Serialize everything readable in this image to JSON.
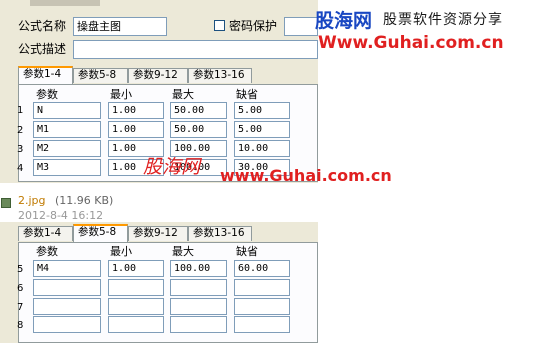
{
  "form": {
    "name_label": "公式名称",
    "name_value": "操盘主图",
    "password_label": "密码保护",
    "desc_label": "公式描述",
    "desc_value": ""
  },
  "tabs": [
    "参数1-4",
    "参数5-8",
    "参数9-12",
    "参数13-16"
  ],
  "columns": [
    "参数",
    "最小",
    "最大",
    "缺省"
  ],
  "panel1": {
    "active_tab": "参数1-4",
    "rows": [
      {
        "num": "1",
        "name": "N",
        "min": "1.00",
        "max": "50.00",
        "default": "5.00"
      },
      {
        "num": "2",
        "name": "M1",
        "min": "1.00",
        "max": "50.00",
        "default": "5.00"
      },
      {
        "num": "3",
        "name": "M2",
        "min": "1.00",
        "max": "100.00",
        "default": "10.00"
      },
      {
        "num": "4",
        "name": "M3",
        "min": "1.00",
        "max": "100.00",
        "default": "30.00"
      }
    ]
  },
  "panel2": {
    "active_tab": "参数5-8",
    "rows": [
      {
        "num": "5",
        "name": "M4",
        "min": "1.00",
        "max": "100.00",
        "default": "60.00"
      },
      {
        "num": "6",
        "name": "",
        "min": "",
        "max": "",
        "default": ""
      },
      {
        "num": "7",
        "name": "",
        "min": "",
        "max": "",
        "default": ""
      },
      {
        "num": "8",
        "name": "",
        "min": "",
        "max": "",
        "default": ""
      }
    ]
  },
  "logo": {
    "title": "股海网",
    "slogan": "股票软件资源分享",
    "url": "Www.Guhai.com.cn"
  },
  "watermark": {
    "cn": "股海网",
    "url": "www.Guhai.com.cn"
  },
  "attachment": {
    "filename": "2.jpg",
    "size": "(11.96 KB)",
    "date": "2012-8-4 16:12"
  },
  "colors": {
    "dialog_bg": "#ece9d8",
    "tab_accent": "#ff9900",
    "brand_blue": "#1947c2",
    "brand_red": "#e02020",
    "link": "#c07a00"
  }
}
